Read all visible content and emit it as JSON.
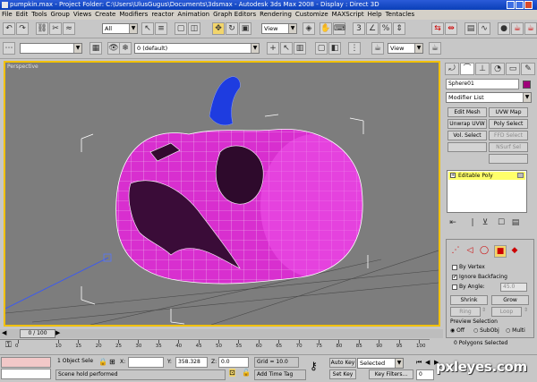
{
  "title_bar": {
    "text": "pumpkin.max  - Project Folder: C:\\Users\\UlusGugus\\Documents\\3dsmax    - Autodesk 3ds Max 2008     - Display : Direct 3D"
  },
  "menu": [
    "File",
    "Edit",
    "Tools",
    "Group",
    "Views",
    "Create",
    "Modifiers",
    "reactor",
    "Animation",
    "Graph Editors",
    "Rendering",
    "Customize",
    "MAXScript",
    "Help",
    "Tentacles"
  ],
  "toolbar": {
    "selection_filter": "All",
    "ref_coord": "View",
    "layer": "0 (default)",
    "view_right": "View"
  },
  "viewport": {
    "label": "Perspective"
  },
  "command_panel": {
    "object_name": "Sphere01",
    "object_color": "#a0007a",
    "modifier_list": "Modifier List",
    "buttons": [
      [
        "Edit Mesh",
        "UVW Map"
      ],
      [
        "Unwrap UVW",
        "Poly Select"
      ],
      [
        "Vol. Select",
        "FFD Select"
      ],
      [
        "",
        "NSurf Sel"
      ]
    ],
    "stack_item": "Editable Poly",
    "by_vertex": "By Vertex",
    "ignore_backfacing": "Ignore Backfacing",
    "by_angle": "By Angle:",
    "by_angle_value": "45.0",
    "shrink": "Shrink",
    "grow": "Grow",
    "ring": "Ring",
    "loop": "Loop",
    "preview_selection": "Preview Selection",
    "preview_off": "Off",
    "preview_subobj": "SubObj",
    "preview_multi": "Multi",
    "selected_info": "0 Polygons Selected"
  },
  "timeline": {
    "frame": "0 / 100",
    "ticks": [
      "0",
      "10",
      "15",
      "20",
      "25",
      "30",
      "35",
      "40",
      "45",
      "50",
      "55",
      "60",
      "65",
      "70",
      "75",
      "80",
      "85",
      "90",
      "95",
      "100"
    ]
  },
  "status": {
    "selection": "1 Object Sele",
    "x_label": "X:",
    "y_label": "Y:",
    "y_value": "358.328",
    "z_label": "Z:",
    "z_value": "0.0",
    "grid": "Grid = 10.0",
    "auto_key": "Auto Key",
    "auto_key_mode": "Selected",
    "set_key": "Set Key",
    "key_filters": "Key Filters...",
    "prompt": "Scene hold performed",
    "add_time_tag": "Add Time Tag",
    "frame_field": "0"
  },
  "watermark": "pxleyes.com"
}
